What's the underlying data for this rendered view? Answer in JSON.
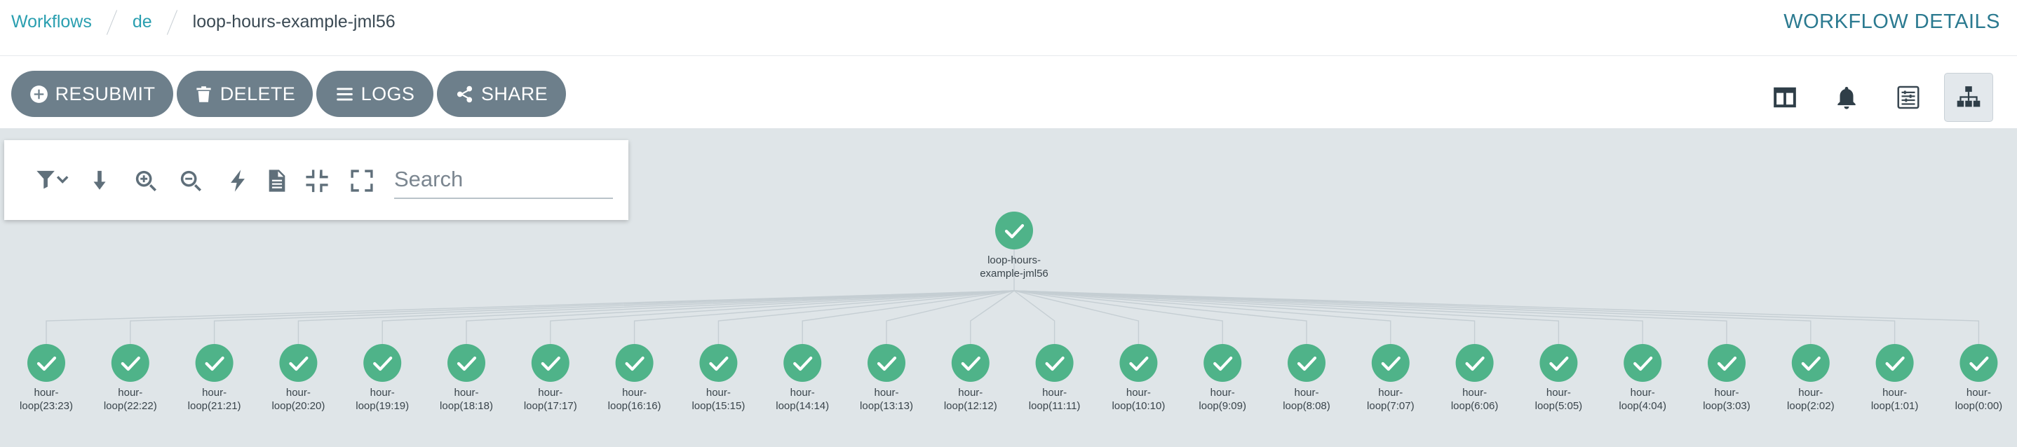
{
  "breadcrumb": {
    "items": [
      "Workflows",
      "de"
    ],
    "current": "loop-hours-example-jml56"
  },
  "page_title": "WORKFLOW DETAILS",
  "actions": {
    "resubmit": "RESUBMIT",
    "delete": "DELETE",
    "logs": "LOGS",
    "share": "SHARE"
  },
  "view_buttons": [
    "split-panel-icon",
    "bell-icon",
    "summary-icon",
    "graph-icon"
  ],
  "graph_tools": {
    "icons": [
      "filter-icon",
      "download-icon",
      "zoom-in-icon",
      "zoom-out-icon",
      "bolt-icon",
      "file-icon",
      "shrink-icon",
      "expand-icon"
    ],
    "search_placeholder": "Search"
  },
  "colors": {
    "accent": "#2a9fb0",
    "title": "#2b7a90",
    "button": "#6d7f8b",
    "graph_bg": "#dfe5e8",
    "node_success": "#4fb389"
  },
  "workflow": {
    "root": {
      "label_lines": [
        "loop-hours-",
        "example-jml56"
      ],
      "status": "succeeded"
    },
    "children": [
      {
        "label_lines": [
          "hour-",
          "loop(23:23)"
        ],
        "status": "succeeded"
      },
      {
        "label_lines": [
          "hour-",
          "loop(22:22)"
        ],
        "status": "succeeded"
      },
      {
        "label_lines": [
          "hour-",
          "loop(21:21)"
        ],
        "status": "succeeded"
      },
      {
        "label_lines": [
          "hour-",
          "loop(20:20)"
        ],
        "status": "succeeded"
      },
      {
        "label_lines": [
          "hour-",
          "loop(19:19)"
        ],
        "status": "succeeded"
      },
      {
        "label_lines": [
          "hour-",
          "loop(18:18)"
        ],
        "status": "succeeded"
      },
      {
        "label_lines": [
          "hour-",
          "loop(17:17)"
        ],
        "status": "succeeded"
      },
      {
        "label_lines": [
          "hour-",
          "loop(16:16)"
        ],
        "status": "succeeded"
      },
      {
        "label_lines": [
          "hour-",
          "loop(15:15)"
        ],
        "status": "succeeded"
      },
      {
        "label_lines": [
          "hour-",
          "loop(14:14)"
        ],
        "status": "succeeded"
      },
      {
        "label_lines": [
          "hour-",
          "loop(13:13)"
        ],
        "status": "succeeded"
      },
      {
        "label_lines": [
          "hour-",
          "loop(12:12)"
        ],
        "status": "succeeded"
      },
      {
        "label_lines": [
          "hour-",
          "loop(11:11)"
        ],
        "status": "succeeded"
      },
      {
        "label_lines": [
          "hour-",
          "loop(10:10)"
        ],
        "status": "succeeded"
      },
      {
        "label_lines": [
          "hour-",
          "loop(9:09)"
        ],
        "status": "succeeded"
      },
      {
        "label_lines": [
          "hour-",
          "loop(8:08)"
        ],
        "status": "succeeded"
      },
      {
        "label_lines": [
          "hour-",
          "loop(7:07)"
        ],
        "status": "succeeded"
      },
      {
        "label_lines": [
          "hour-",
          "loop(6:06)"
        ],
        "status": "succeeded"
      },
      {
        "label_lines": [
          "hour-",
          "loop(5:05)"
        ],
        "status": "succeeded"
      },
      {
        "label_lines": [
          "hour-",
          "loop(4:04)"
        ],
        "status": "succeeded"
      },
      {
        "label_lines": [
          "hour-",
          "loop(3:03)"
        ],
        "status": "succeeded"
      },
      {
        "label_lines": [
          "hour-",
          "loop(2:02)"
        ],
        "status": "succeeded"
      },
      {
        "label_lines": [
          "hour-",
          "loop(1:01)"
        ],
        "status": "succeeded"
      },
      {
        "label_lines": [
          "hour-",
          "loop(0:00)"
        ],
        "status": "succeeded"
      }
    ]
  }
}
